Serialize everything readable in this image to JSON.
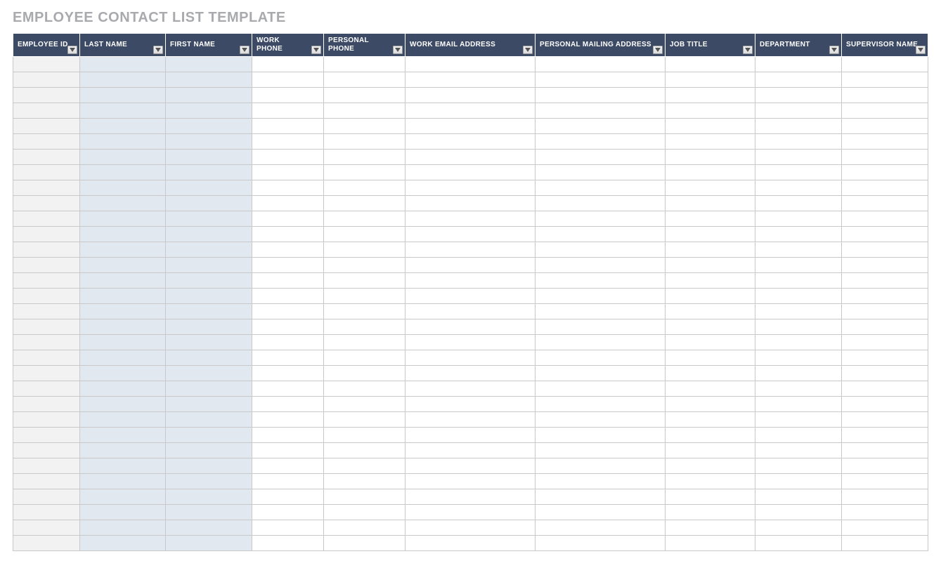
{
  "title": "EMPLOYEE CONTACT LIST TEMPLATE",
  "columns": [
    {
      "label": "EMPLOYEE ID"
    },
    {
      "label": "LAST NAME"
    },
    {
      "label": "FIRST NAME"
    },
    {
      "label": "WORK PHONE"
    },
    {
      "label": "PERSONAL PHONE"
    },
    {
      "label": "WORK EMAIL ADDRESS"
    },
    {
      "label": "PERSONAL MAILING ADDRESS"
    },
    {
      "label": "JOB TITLE"
    },
    {
      "label": "DEPARTMENT"
    },
    {
      "label": "SUPERVISOR NAME"
    }
  ],
  "row_count": 32,
  "colors": {
    "header_bg": "#3c4a66",
    "header_fg": "#ffffff",
    "title_fg": "#a9aaae",
    "col0_bg": "#f2f2f2",
    "col12_bg": "#e1e8f0",
    "grid": "#c9c9c9"
  }
}
